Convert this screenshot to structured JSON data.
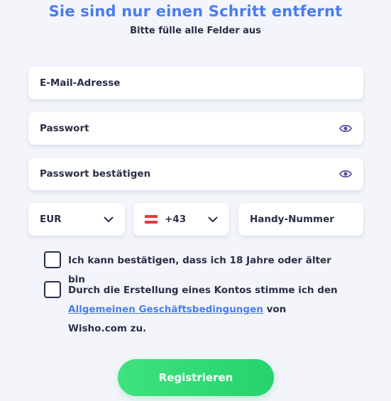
{
  "header": {
    "title": "Sie sind nur einen Schritt entfernt",
    "subtitle": "Bitte fülle alle Felder aus"
  },
  "form": {
    "email_placeholder": "E-Mail-Adresse",
    "password_placeholder": "Passwort",
    "password_confirm_placeholder": "Passwort bestätigen",
    "currency": "EUR",
    "country_code": "+43",
    "phone_placeholder": "Handy-Nummer"
  },
  "checkboxes": {
    "age_label": "Ich kann bestätigen, dass ich 18 Jahre oder älter bin",
    "terms_prefix": "Durch die Erstellung eines Kontos stimme ich den",
    "terms_link": "Allgemeinen Geschäftsbedingungen",
    "terms_suffix": "von Wisho.com zu."
  },
  "actions": {
    "register_label": "Registrieren"
  },
  "icons": {
    "password_toggle": "eye-icon",
    "dropdown": "chevron-down-icon",
    "flag": "austria-flag-icon"
  },
  "colors": {
    "accent": "#4a7cf0",
    "button": "#2fd973",
    "eye": "#5b4d9e"
  }
}
